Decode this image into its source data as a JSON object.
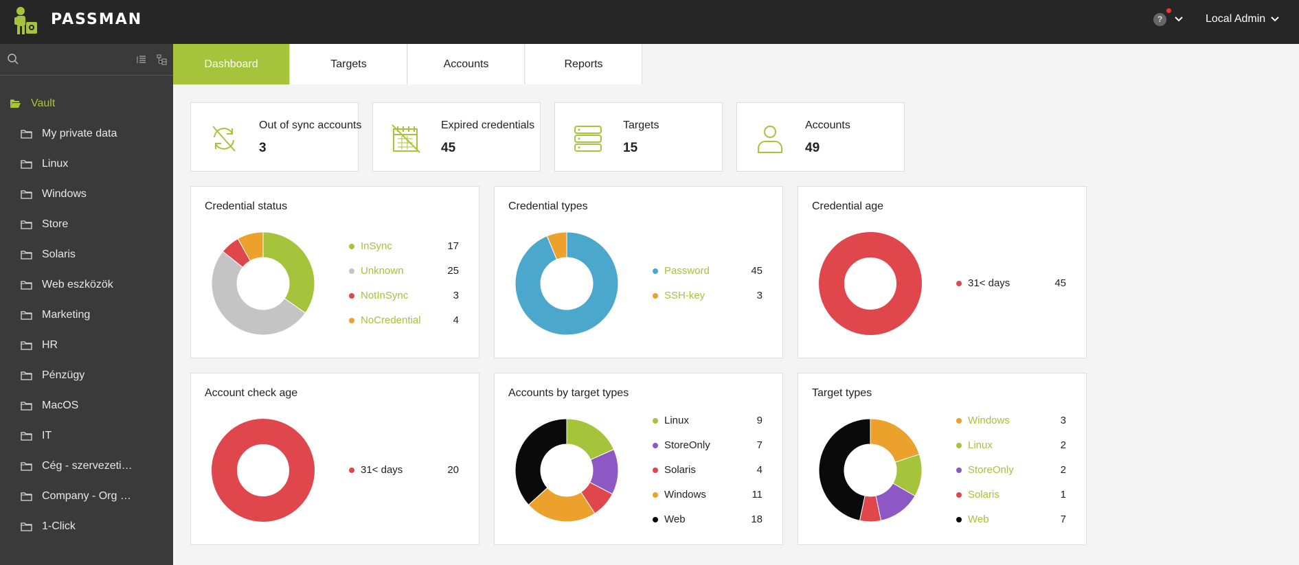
{
  "app": {
    "brand": "PASSMAN",
    "help_label": "?",
    "user": "Local Admin"
  },
  "sidebar": {
    "search_placeholder": "",
    "root": "Vault",
    "items": [
      "My private data",
      "Linux",
      "Windows",
      "Store",
      "Solaris",
      "Web eszközök",
      "Marketing",
      "HR",
      "Pénzügy",
      "MacOS",
      "IT",
      "Cég - szervezeti…",
      "Company - Org …",
      "1-Click"
    ]
  },
  "tabs": [
    "Dashboard",
    "Targets",
    "Accounts",
    "Reports"
  ],
  "stats": [
    {
      "label": "Out of sync accounts",
      "value": "3",
      "icon": "sync-off-icon"
    },
    {
      "label": "Expired credentials",
      "value": "45",
      "icon": "expired-calendar-icon"
    },
    {
      "label": "Targets",
      "value": "15",
      "icon": "server-icon"
    },
    {
      "label": "Accounts",
      "value": "49",
      "icon": "user-icon"
    }
  ],
  "colors": {
    "green": "#a5c33b",
    "gray": "#c4c4c4",
    "red": "#e0474c",
    "orange": "#eba12c",
    "blue": "#4ba8cc",
    "purple": "#8d57c4",
    "black": "#0a0a0a",
    "brand": "#a5c33b"
  },
  "chart_data": [
    {
      "type": "pie",
      "title": "Credential status",
      "series": [
        {
          "name": "InSync",
          "value": 17,
          "color": "#a5c33b",
          "link": true
        },
        {
          "name": "Unknown",
          "value": 25,
          "color": "#c4c4c4",
          "link": true
        },
        {
          "name": "NotInSync",
          "value": 3,
          "color": "#e0474c",
          "link": true
        },
        {
          "name": "NoCredential",
          "value": 4,
          "color": "#eba12c",
          "link": true
        }
      ]
    },
    {
      "type": "pie",
      "title": "Credential types",
      "series": [
        {
          "name": "Password",
          "value": 45,
          "color": "#4ba8cc",
          "link": true
        },
        {
          "name": "SSH-key",
          "value": 3,
          "color": "#eba12c",
          "link": true
        }
      ]
    },
    {
      "type": "pie",
      "title": "Credential age",
      "series": [
        {
          "name": "31< days",
          "value": 45,
          "color": "#e0474c",
          "link": false
        }
      ]
    },
    {
      "type": "pie",
      "title": "Account check age",
      "series": [
        {
          "name": "31< days",
          "value": 20,
          "color": "#e0474c",
          "link": false
        }
      ]
    },
    {
      "type": "pie",
      "title": "Accounts by target types",
      "series": [
        {
          "name": "Linux",
          "value": 9,
          "color": "#a5c33b",
          "link": false
        },
        {
          "name": "StoreOnly",
          "value": 7,
          "color": "#8d57c4",
          "link": false
        },
        {
          "name": "Solaris",
          "value": 4,
          "color": "#e0474c",
          "link": false
        },
        {
          "name": "Windows",
          "value": 11,
          "color": "#eba12c",
          "link": false
        },
        {
          "name": "Web",
          "value": 18,
          "color": "#0a0a0a",
          "link": false
        }
      ]
    },
    {
      "type": "pie",
      "title": "Target types",
      "series": [
        {
          "name": "Windows",
          "value": 3,
          "color": "#eba12c",
          "link": true
        },
        {
          "name": "Linux",
          "value": 2,
          "color": "#a5c33b",
          "link": true
        },
        {
          "name": "StoreOnly",
          "value": 2,
          "color": "#8d57c4",
          "link": true
        },
        {
          "name": "Solaris",
          "value": 1,
          "color": "#e0474c",
          "link": true
        },
        {
          "name": "Web",
          "value": 7,
          "color": "#0a0a0a",
          "link": true
        }
      ]
    }
  ]
}
